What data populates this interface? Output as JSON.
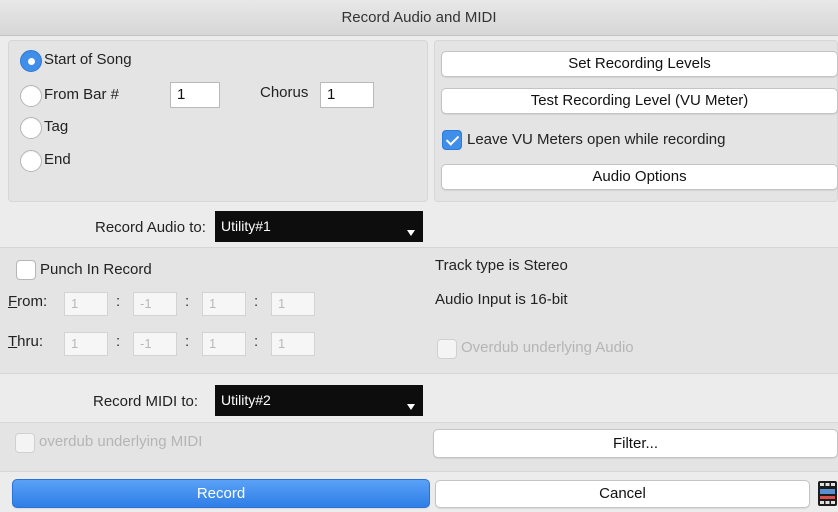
{
  "window": {
    "title": "Record Audio and MIDI"
  },
  "start_position": {
    "options": [
      {
        "label": "Start of Song",
        "selected": true
      },
      {
        "label": "From Bar #",
        "selected": false
      },
      {
        "label": "Tag",
        "selected": false
      },
      {
        "label": "End",
        "selected": false
      }
    ],
    "bar_value": "1",
    "chorus_label": "Chorus",
    "chorus_value": "1"
  },
  "levels": {
    "set_levels_label": "Set Recording Levels",
    "test_level_label": "Test Recording Level (VU Meter)",
    "leave_vu_label": "Leave VU Meters open while recording",
    "leave_vu_checked": true,
    "audio_options_label": "Audio Options"
  },
  "record_audio": {
    "label": "Record Audio to:",
    "value": "Utility#1"
  },
  "punch": {
    "label": "Punch In Record",
    "checked": false,
    "from_label": "From:",
    "thru_label": "Thru:",
    "from_values": [
      "1",
      "-1",
      "1",
      "1"
    ],
    "thru_values": [
      "1",
      "-1",
      "1",
      "1"
    ],
    "separator": ":"
  },
  "track_info": {
    "track_type": "Track type is Stereo",
    "audio_input": "Audio Input is 16-bit",
    "overdub_audio_label": "Overdub underlying Audio"
  },
  "record_midi": {
    "label": "Record MIDI to:",
    "value": "Utility#2"
  },
  "midi": {
    "overdub_midi_label": "overdub underlying MIDI",
    "filter_label": "Filter..."
  },
  "footer": {
    "record_label": "Record",
    "cancel_label": "Cancel"
  },
  "colors": {
    "accent": "#3f8fea",
    "dropdown_bg": "#0d0d0d",
    "dialog_bg": "#ececec"
  }
}
